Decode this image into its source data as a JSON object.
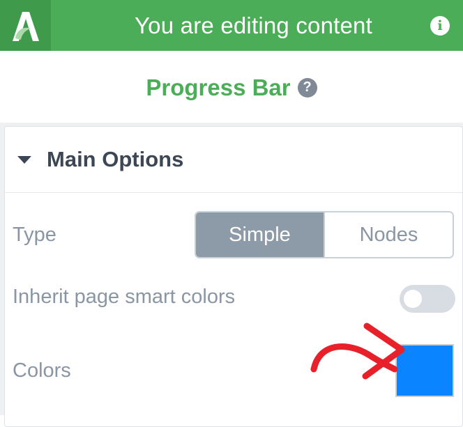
{
  "header": {
    "title": "You are editing content",
    "logo_icon": "logo-icon",
    "info_icon": "info-icon",
    "info_glyph": "i",
    "color": "#4bad57"
  },
  "module": {
    "title": "Progress Bar",
    "help_icon": "question-icon",
    "help_glyph": "?"
  },
  "section": {
    "title": "Main Options",
    "expanded": true
  },
  "options": {
    "type": {
      "label": "Type",
      "choices": [
        "Simple",
        "Nodes"
      ],
      "selected": "Simple"
    },
    "inherit": {
      "label": "Inherit page smart colors",
      "enabled": false
    },
    "colors": {
      "label": "Colors",
      "value": "#0a84ff"
    }
  },
  "annotation": {
    "icon": "red-arrow-icon",
    "color": "#e8202a"
  }
}
